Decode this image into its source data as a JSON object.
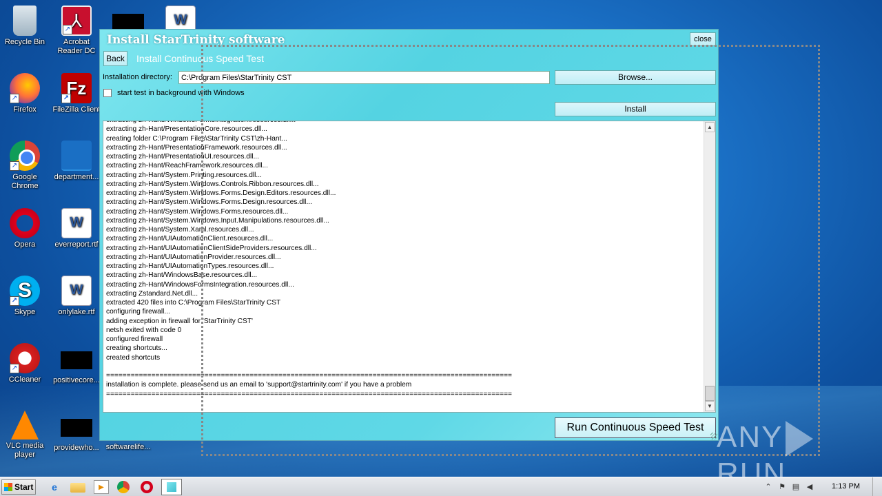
{
  "desktop": {
    "icons": [
      {
        "label": "Recycle Bin",
        "icon": "recycle-bin-icon"
      },
      {
        "label": "Acrobat Reader DC",
        "icon": "acrobat-icon"
      },
      {
        "label": "",
        "icon": "black-thumbnail-icon"
      },
      {
        "label": "",
        "icon": "word-document-icon"
      },
      {
        "label": "Firefox",
        "icon": "firefox-icon"
      },
      {
        "label": "FileZilla Client",
        "icon": "filezilla-icon"
      },
      {
        "label": "Google Chrome",
        "icon": "chrome-icon"
      },
      {
        "label": "department...",
        "icon": "blue-thumbnail-icon"
      },
      {
        "label": "Opera",
        "icon": "opera-icon"
      },
      {
        "label": "everreport.rtf",
        "icon": "word-document-icon"
      },
      {
        "label": "Skype",
        "icon": "skype-icon"
      },
      {
        "label": "onlylake.rtf",
        "icon": "word-document-icon"
      },
      {
        "label": "CCleaner",
        "icon": "ccleaner-icon"
      },
      {
        "label": "positivecore...",
        "icon": "black-thumbnail-icon"
      },
      {
        "label": "VLC media player",
        "icon": "vlc-icon"
      },
      {
        "label": "providewho...",
        "icon": "black-thumbnail-icon"
      },
      {
        "label": "softwarelife...",
        "icon": "blue-thumbnail-icon"
      }
    ]
  },
  "installer": {
    "title": "Install StarTrinity software",
    "close_label": "close",
    "back_label": "Back",
    "subtitle": "Install Continuous Speed Test",
    "dir_label": "Installation directory:",
    "dir_value": "C:\\Program Files\\StarTrinity CST",
    "browse_label": "Browse...",
    "checkbox_label": "start test in background with Windows",
    "checkbox_checked": false,
    "install_label": "Install",
    "run_label": "Run Continuous Speed Test",
    "log_lines": [
      "extracting zh-Hans/WindowsFormsIntegration.resources.dll...",
      "extracting zh-Hant/PresentationCore.resources.dll...",
      "creating folder C:\\Program Files\\StarTrinity CST\\zh-Hant...",
      "extracting zh-Hant/PresentationFramework.resources.dll...",
      "extracting zh-Hant/PresentationUI.resources.dll...",
      "extracting zh-Hant/ReachFramework.resources.dll...",
      "extracting zh-Hant/System.Printing.resources.dll...",
      "extracting zh-Hant/System.Windows.Controls.Ribbon.resources.dll...",
      "extracting zh-Hant/System.Windows.Forms.Design.Editors.resources.dll...",
      "extracting zh-Hant/System.Windows.Forms.Design.resources.dll...",
      "extracting zh-Hant/System.Windows.Forms.resources.dll...",
      "extracting zh-Hant/System.Windows.Input.Manipulations.resources.dll...",
      "extracting zh-Hant/System.Xaml.resources.dll...",
      "extracting zh-Hant/UIAutomationClient.resources.dll...",
      "extracting zh-Hant/UIAutomationClientSideProviders.resources.dll...",
      "extracting zh-Hant/UIAutomationProvider.resources.dll...",
      "extracting zh-Hant/UIAutomationTypes.resources.dll...",
      "extracting zh-Hant/WindowsBase.resources.dll...",
      "extracting zh-Hant/WindowsFormsIntegration.resources.dll...",
      "extracting Zstandard.Net.dll...",
      "extracted 420 files into C:\\Program Files\\StarTrinity CST",
      "configuring firewall...",
      "adding exception in firewall for 'StarTrinity CST'",
      "netsh exited with code 0",
      "configured firewall",
      "creating shortcuts...",
      "created shortcuts",
      "",
      "===================================================================================================",
      "installation is complete. please send us an email to 'support@startrinity.com' if you have a problem",
      "==================================================================================================="
    ]
  },
  "watermark": {
    "text_left": "ANY",
    "text_right": "RUN"
  },
  "taskbar": {
    "start_label": "Start",
    "clock": "1:13 PM"
  }
}
